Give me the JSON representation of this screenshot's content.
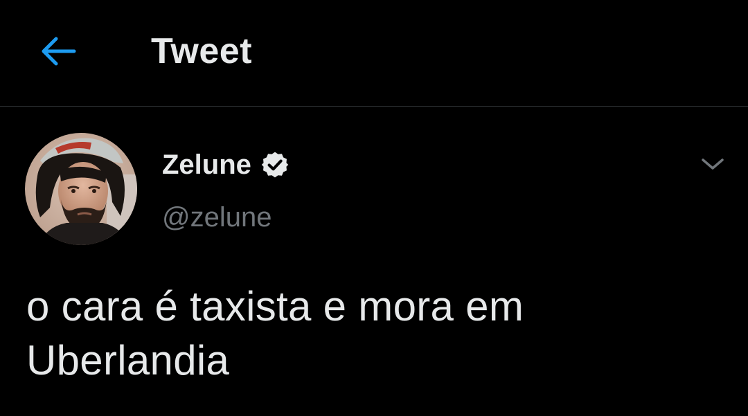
{
  "header": {
    "back_icon": "arrow-left-icon",
    "title": "Tweet"
  },
  "tweet": {
    "author": {
      "name": "Zelune",
      "handle": "@zelune",
      "verified": true,
      "verified_icon": "verified-badge-icon",
      "avatar": "avatar-photo"
    },
    "menu_icon": "chevron-down-icon",
    "text_lines": [
      "o cara é taxista e mora em",
      "Uberlandia"
    ]
  },
  "colors": {
    "background": "#000000",
    "accent": "#1d9bf0",
    "primary_text": "#e7e9ea",
    "secondary_text": "#71767b",
    "divider": "#2f3336"
  }
}
